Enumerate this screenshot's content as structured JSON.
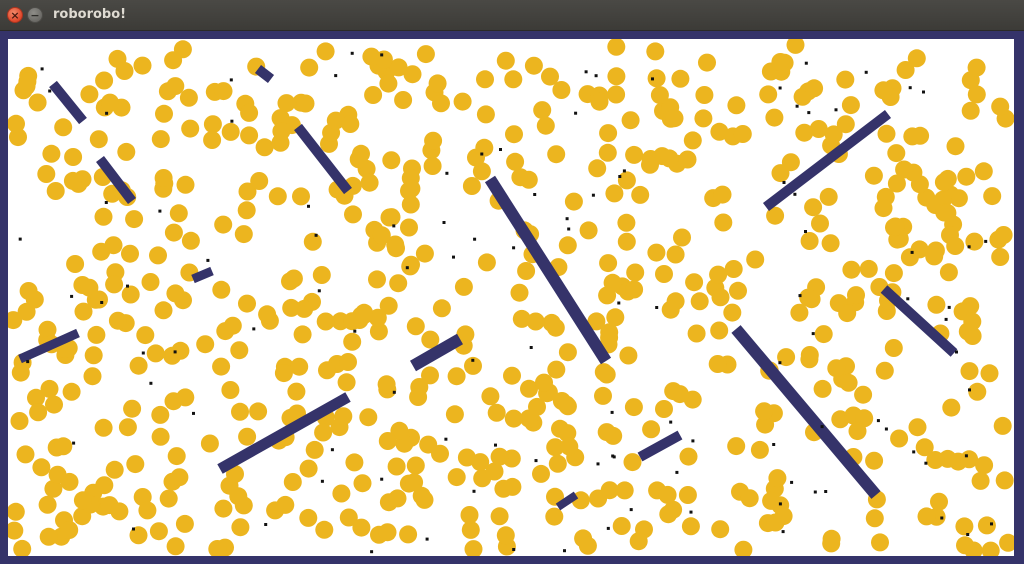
{
  "window": {
    "title": "roborobo!",
    "close_glyph": "×",
    "minimize_glyph": "−",
    "close_icon": "close-icon",
    "minimize_icon": "minimize-icon"
  },
  "simulation": {
    "background_color": "#ffffff",
    "border_color": "#35336a",
    "food_color": "#ecb51f",
    "wall_color": "#35336a",
    "robot_color": "#111111",
    "food_item_count_estimate": 650,
    "robot_count_estimate": 110
  }
}
